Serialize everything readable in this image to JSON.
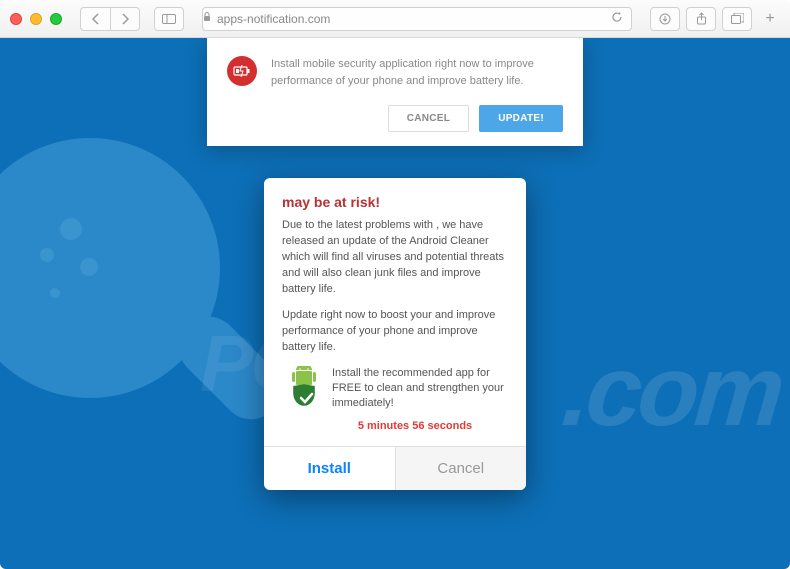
{
  "urlbar": {
    "domain": "apps-notification.com"
  },
  "top_notification": {
    "text": "Install mobile security application right now to improve performance of your phone and improve battery life.",
    "cancel_label": "CANCEL",
    "update_label": "UPDATE!"
  },
  "modal": {
    "title": "may be at risk!",
    "p1": "Due to the latest problems with , we have released an update of the Android Cleaner which will find all viruses and potential threats and will also clean junk files and improve battery life.",
    "p2": "Update right now to boost your and improve performance of your phone and improve battery life.",
    "recommend": "Install the recommended app for FREE to clean and strengthen your immediately!",
    "countdown": "5 minutes 56 seconds",
    "install_label": "Install",
    "cancel_label": "Cancel"
  },
  "icons": {
    "battery": "battery-low-icon",
    "android": "android-shield-icon"
  }
}
